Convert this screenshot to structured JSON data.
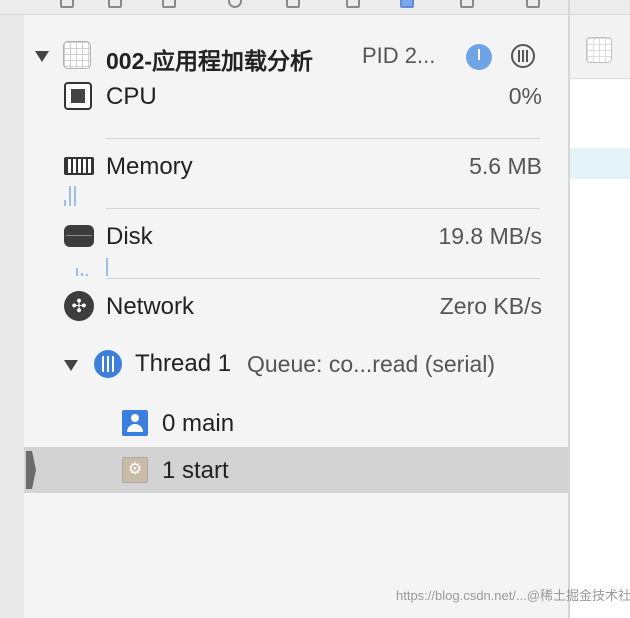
{
  "process": {
    "title": "002-应用程加载分析",
    "pid": "PID 2..."
  },
  "metrics": [
    {
      "label": "CPU",
      "value": "0%"
    },
    {
      "label": "Memory",
      "value": "5.6 MB"
    },
    {
      "label": "Disk",
      "value": "19.8 MB/s"
    },
    {
      "label": "Network",
      "value": "Zero KB/s"
    }
  ],
  "thread": {
    "label": "Thread 1",
    "queue": "Queue: co...read (serial)"
  },
  "frames": [
    {
      "label": "0 main",
      "icon": "person-icon"
    },
    {
      "label": "1 start",
      "icon": "gear-icon",
      "selected": true
    }
  ],
  "watermark": "https://blog.csdn.net/...@稀土掘金技术社区",
  "colors": {
    "accent": "#3f7fdc",
    "selection": "#d3d3d3",
    "graph_bar": "#9dbce8",
    "panel_bg": "#f4f4f4"
  }
}
